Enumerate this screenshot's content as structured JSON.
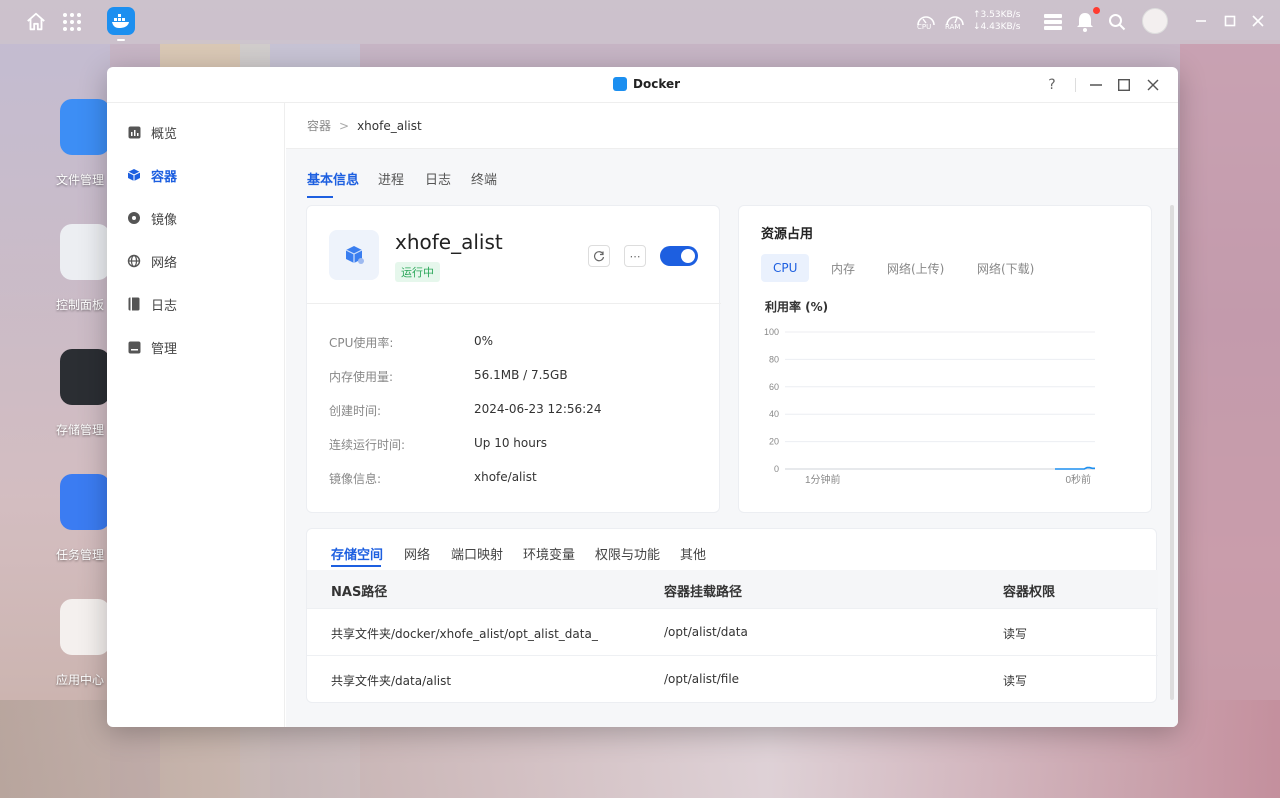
{
  "topbar": {
    "cpu_label": "CPU",
    "ram_label": "RAM",
    "net_up": "↑3.53KB/s",
    "net_down": "↓4.43KB/s"
  },
  "desktop": {
    "items": [
      {
        "label": "文件管理"
      },
      {
        "label": "控制面板"
      },
      {
        "label": "存储管理"
      },
      {
        "label": "任务管理"
      },
      {
        "label": "应用中心"
      }
    ]
  },
  "window": {
    "title": "Docker",
    "help": "?"
  },
  "sidebar": {
    "items": [
      {
        "label": "概览"
      },
      {
        "label": "容器"
      },
      {
        "label": "镜像"
      },
      {
        "label": "网络"
      },
      {
        "label": "日志"
      },
      {
        "label": "管理"
      }
    ]
  },
  "breadcrumb": {
    "parent": "容器",
    "sep": ">",
    "current": "xhofe_alist"
  },
  "tabs": [
    "基本信息",
    "进程",
    "日志",
    "终端"
  ],
  "container": {
    "name": "xhofe_alist",
    "status": "运行中",
    "more": "⋯",
    "enabled": true,
    "rows": [
      {
        "k": "CPU使用率:",
        "v": "0%"
      },
      {
        "k": "内存使用量:",
        "v": "56.1MB / 7.5GB"
      },
      {
        "k": "创建时间:",
        "v": "2024-06-23 12:56:24"
      },
      {
        "k": "连续运行时间:",
        "v": "Up 10 hours"
      },
      {
        "k": "镜像信息:",
        "v": "xhofe/alist"
      }
    ]
  },
  "resource": {
    "title": "资源占用",
    "tabs": [
      "CPU",
      "内存",
      "网络(上传)",
      "网络(下载)"
    ],
    "active_tab": "CPU",
    "util_label": "利用率 (%)"
  },
  "chart_data": {
    "type": "line",
    "title": "",
    "ylabel": "利用率 (%)",
    "ylim": [
      0,
      100
    ],
    "yticks": [
      0,
      20,
      40,
      60,
      80,
      100
    ],
    "x_labels": [
      "1分钟前",
      "0秒前"
    ],
    "series": [
      {
        "values": [
          0,
          0,
          0,
          0,
          0,
          0,
          0,
          0,
          0,
          0,
          0,
          0,
          1,
          1,
          0.5,
          0.5
        ]
      }
    ],
    "grid": true,
    "color": "#1d8ff0"
  },
  "bottom": {
    "tabs": [
      "存储空间",
      "网络",
      "端口映射",
      "环境变量",
      "权限与功能",
      "其他"
    ],
    "headers": [
      "NAS路径",
      "容器挂载路径",
      "容器权限"
    ],
    "rows": [
      {
        "nas": "共享文件夹/docker/xhofe_alist/opt_alist_data_",
        "mount": "/opt/alist/data",
        "perm": "读写"
      },
      {
        "nas": "共享文件夹/data/alist",
        "mount": "/opt/alist/file",
        "perm": "读写"
      }
    ]
  }
}
